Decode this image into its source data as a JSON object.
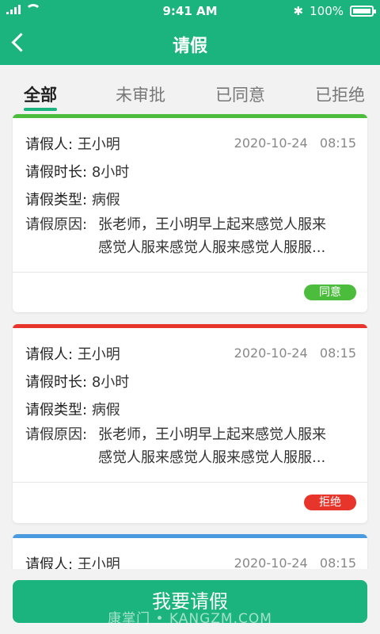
{
  "status": {
    "time": "9:41 AM",
    "battery_text": "100%"
  },
  "header": {
    "title": "请假"
  },
  "tabs": [
    {
      "label": "全部",
      "active": true
    },
    {
      "label": "未审批",
      "active": false
    },
    {
      "label": "已同意",
      "active": false
    },
    {
      "label": "已拒绝",
      "active": false
    }
  ],
  "labels": {
    "applicant": "请假人:",
    "duration": "请假时长:",
    "type": "请假类型:",
    "reason": "请假原因:"
  },
  "cards": [
    {
      "color": "#4cbc3c",
      "name": "王小明",
      "date": "2020-10-24",
      "time": "08:15",
      "duration": "8小时",
      "type": "病假",
      "reason_line1": "张老师，王小明早上起来感觉人服来",
      "reason_line2": "感觉人服来感觉人服来感觉人服服...",
      "status": "同意",
      "status_color": "#4cbc3c"
    },
    {
      "color": "#e8352b",
      "name": "王小明",
      "date": "2020-10-24",
      "time": "08:15",
      "duration": "8小时",
      "type": "病假",
      "reason_line1": "张老师，王小明早上起来感觉人服来",
      "reason_line2": "感觉人服来感觉人服来感觉人服服...",
      "status": "拒绝",
      "status_color": "#e8352b"
    },
    {
      "color": "#4a9ae0",
      "name": "王小明",
      "date": "2020-10-24",
      "time": "08:15"
    }
  ],
  "footer": {
    "button_label": "我要请假",
    "watermark": "康掌门 • KANGZM.COM"
  }
}
